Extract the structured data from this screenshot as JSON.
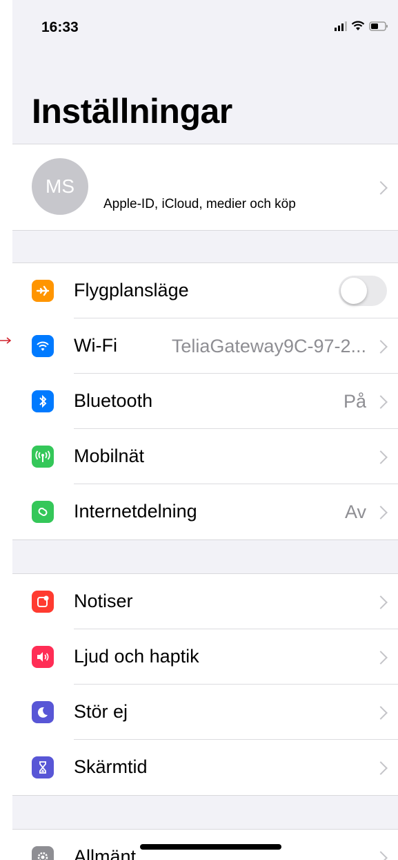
{
  "status_bar": {
    "time": "16:33"
  },
  "title": "Inställningar",
  "profile": {
    "initials": "MS",
    "subtitle": "Apple-ID, iCloud, medier och köp"
  },
  "groups": [
    {
      "rows": [
        {
          "label": "Flygplansläge",
          "icon": "airplane-icon",
          "color": "#ff9500",
          "toggle": false
        },
        {
          "label": "Wi-Fi",
          "value": "TeliaGateway9C-97-2...",
          "icon": "wifi-icon",
          "color": "#007aff"
        },
        {
          "label": "Bluetooth",
          "value": "På",
          "icon": "bluetooth-icon",
          "color": "#007aff"
        },
        {
          "label": "Mobilnät",
          "icon": "antenna-icon",
          "color": "#34c759"
        },
        {
          "label": "Internetdelning",
          "value": "Av",
          "icon": "link-icon",
          "color": "#34c759"
        }
      ]
    },
    {
      "rows": [
        {
          "label": "Notiser",
          "icon": "notifications-icon",
          "color": "#ff3b30"
        },
        {
          "label": "Ljud och haptik",
          "icon": "speaker-icon",
          "color": "#ff2d55"
        },
        {
          "label": "Stör ej",
          "icon": "moon-icon",
          "color": "#5856d6"
        },
        {
          "label": "Skärmtid",
          "icon": "hourglass-icon",
          "color": "#5856d6"
        }
      ]
    },
    {
      "rows": [
        {
          "label": "Allmänt",
          "icon": "gear-icon",
          "color": "#8e8e93"
        }
      ]
    }
  ]
}
